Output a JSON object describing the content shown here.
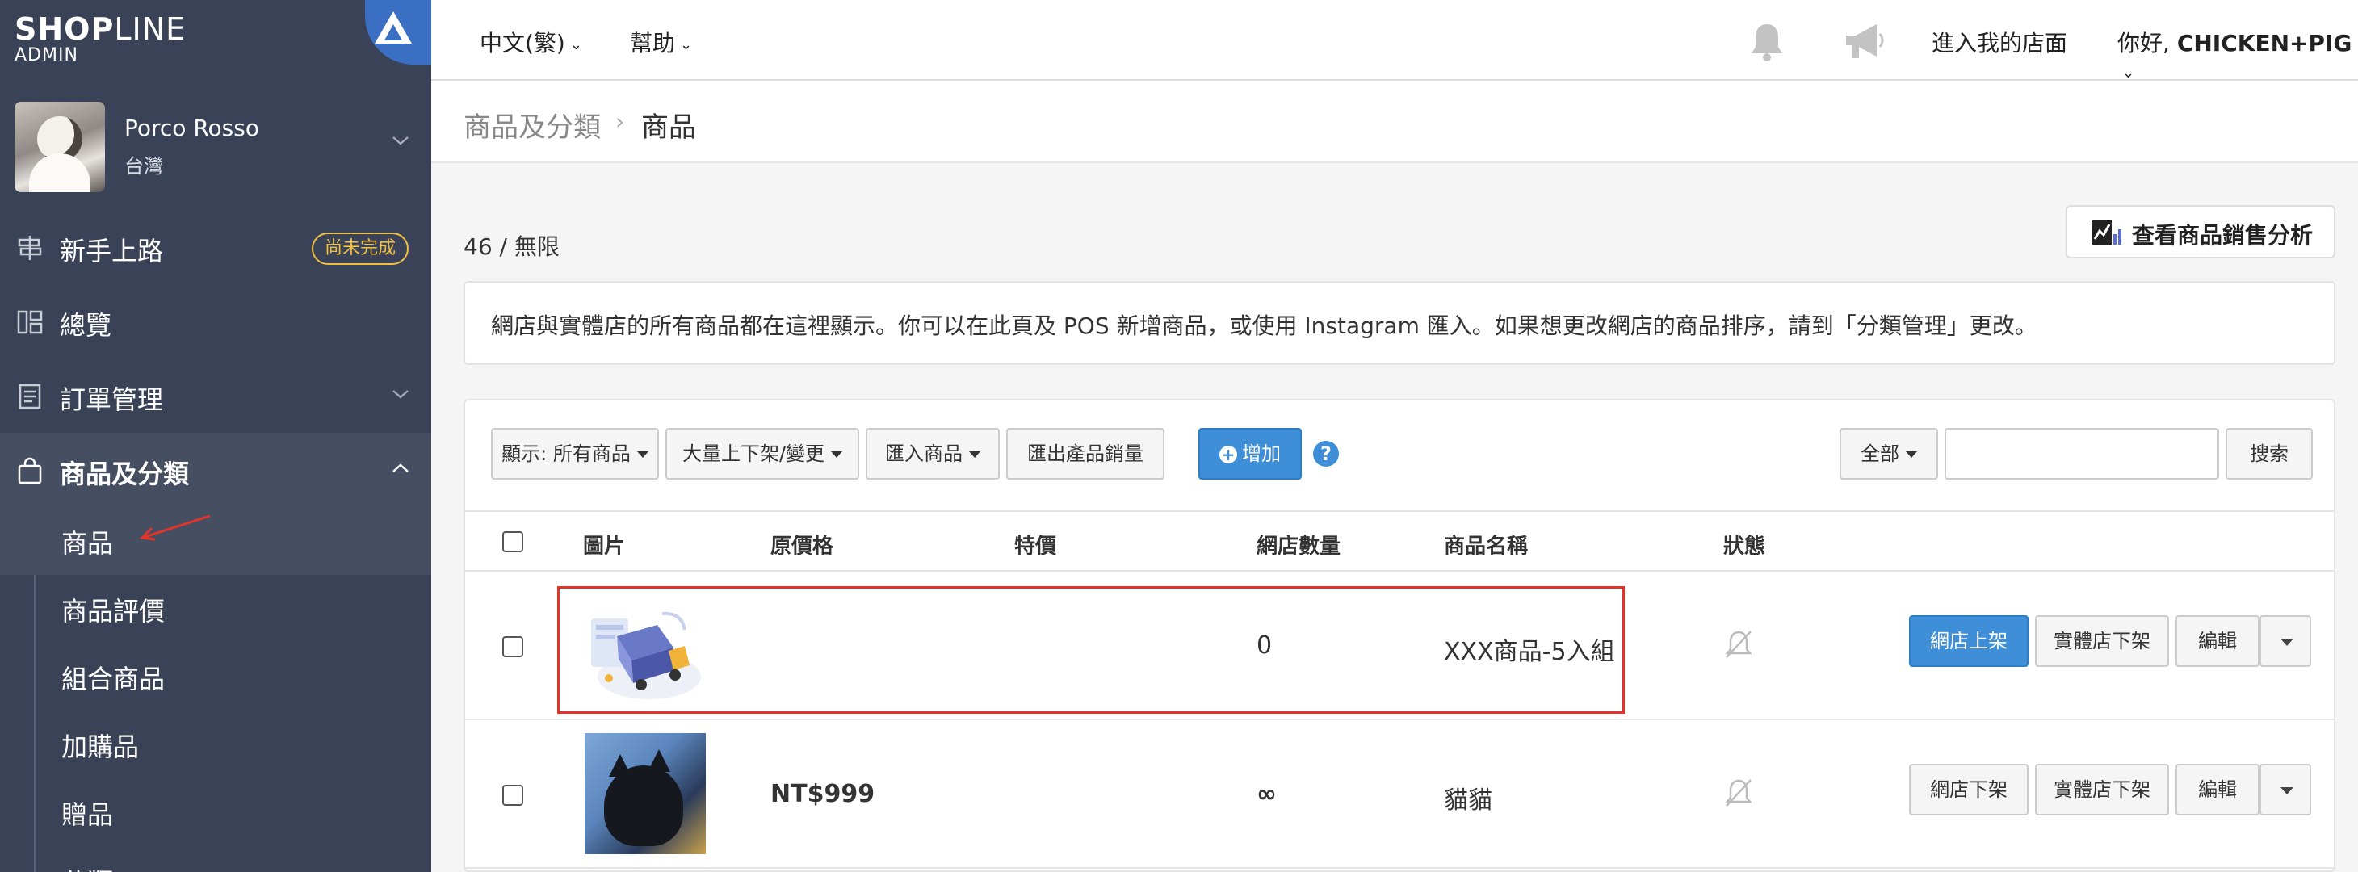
{
  "logo": {
    "brand_part1": "SHOP",
    "brand_part2": "LINE",
    "sub": "ADMIN"
  },
  "profile": {
    "name": "Porco Rosso",
    "region": "台灣"
  },
  "sidebar": {
    "items": [
      {
        "label": "新手上路",
        "badge": "尚未完成"
      },
      {
        "label": "總覽"
      },
      {
        "label": "訂單管理"
      },
      {
        "label": "商品及分類"
      }
    ],
    "subitems": [
      "商品",
      "商品評價",
      "組合商品",
      "加購品",
      "贈品",
      "分類"
    ]
  },
  "topbar": {
    "language": "中文(繁)",
    "help": "幫助",
    "enter_store": "進入我的店面",
    "greeting_prefix": "你好, ",
    "greeting_name": "CHICKEN+PIG"
  },
  "breadcrumb": {
    "parent": "商品及分類",
    "separator": "›",
    "current": "商品"
  },
  "count": "46 / 無限",
  "analysis_button": "查看商品銷售分析",
  "info": "網店與實體店的所有商品都在這裡顯示。你可以在此頁及 POS 新增商品，或使用 Instagram 匯入。如果想更改網店的商品排序，請到「分類管理」更改。",
  "toolbar": {
    "display": "顯示: 所有商品",
    "bulk": "大量上下架/變更",
    "import": "匯入商品",
    "export": "匯出產品銷量",
    "add": "增加",
    "help_icon": "?",
    "filter": "全部",
    "search_value": "",
    "search": "搜索"
  },
  "table": {
    "headers": [
      "圖片",
      "原價格",
      "特價",
      "網店數量",
      "商品名稱",
      "狀態"
    ],
    "rows": [
      {
        "price": "",
        "sale_price": "",
        "quantity": "0",
        "name": "XXX商品-5入組",
        "status_icon": "bell-off-icon",
        "actions": [
          "網店上架",
          "實體店下架",
          "編輯"
        ]
      },
      {
        "price": "NT$999",
        "sale_price": "",
        "quantity": "∞",
        "name": "貓貓",
        "status_icon": "bell-off-icon",
        "actions": [
          "網店下架",
          "實體店下架",
          "編輯"
        ]
      }
    ]
  },
  "colors": {
    "sidebar": "#3a4257",
    "accent": "#3f8ed8",
    "badge": "#f0c040",
    "annotation": "#e0352b"
  }
}
